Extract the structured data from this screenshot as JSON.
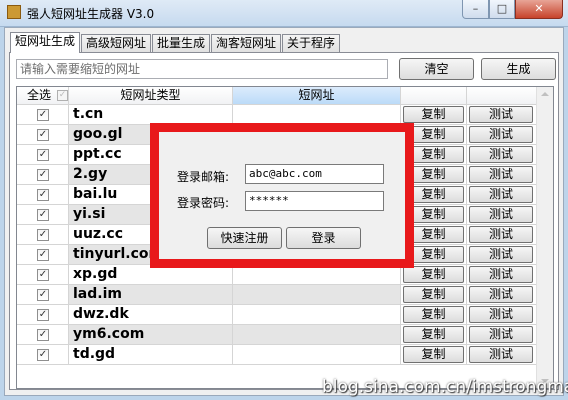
{
  "window": {
    "title": "强人短网址生成器 V3.0",
    "controls": {
      "minimize": "–",
      "maximize": "□",
      "close": "✕"
    }
  },
  "tabs": [
    {
      "label": "短网址生成",
      "active": true
    },
    {
      "label": "高级短网址",
      "active": false
    },
    {
      "label": "批量生成",
      "active": false
    },
    {
      "label": "淘客短网址",
      "active": false
    },
    {
      "label": "关于程序",
      "active": false
    }
  ],
  "url_input": {
    "placeholder": "请输入需要缩短的网址",
    "value": ""
  },
  "toolbar": {
    "clear_label": "清空",
    "generate_label": "生成"
  },
  "grid": {
    "headers": {
      "select_all": "全选",
      "type": "短网址类型",
      "short_url": "短网址",
      "action1": "",
      "action2": ""
    },
    "copy_label": "复制",
    "test_label": "测试",
    "check_mark": "✓",
    "rows": [
      {
        "type": "t.cn",
        "checked": true
      },
      {
        "type": "goo.gl",
        "checked": true
      },
      {
        "type": "ppt.cc",
        "checked": true
      },
      {
        "type": "2.gy",
        "checked": true
      },
      {
        "type": "bai.lu",
        "checked": true
      },
      {
        "type": "yi.si",
        "checked": true
      },
      {
        "type": "uuz.cc",
        "checked": true
      },
      {
        "type": "tinyurl.com",
        "checked": true
      },
      {
        "type": "xp.gd",
        "checked": true
      },
      {
        "type": "lad.im",
        "checked": true
      },
      {
        "type": "dwz.dk",
        "checked": true
      },
      {
        "type": "ym6.com",
        "checked": true
      },
      {
        "type": "td.gd",
        "checked": true
      }
    ]
  },
  "login_dialog": {
    "email_label": "登录邮箱:",
    "email_value": "abc@abc.com",
    "password_label": "登录密码:",
    "password_value": "******",
    "register_label": "快速注册",
    "login_label": "登录",
    "highlight_color": "#e8191b"
  },
  "watermark": "blog.sina.com.cn/imstrongman"
}
